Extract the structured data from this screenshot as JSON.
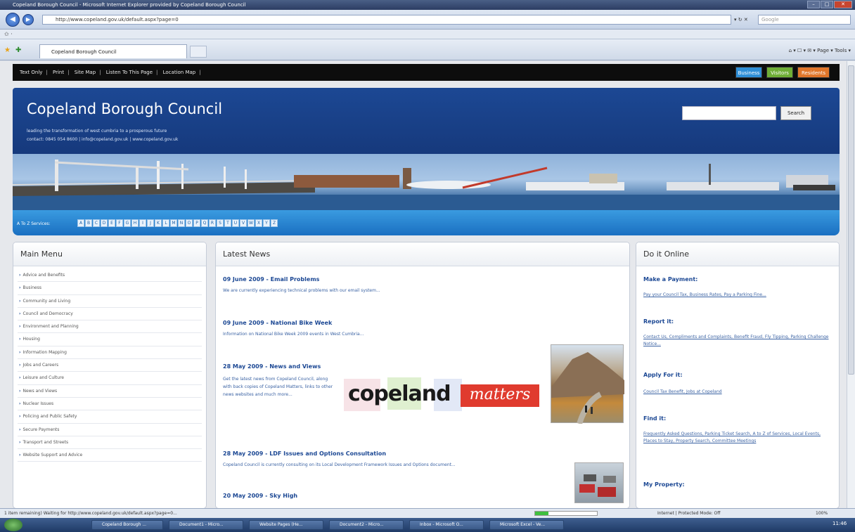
{
  "window": {
    "title": "Copeland Borough Council - Microsoft Internet Explorer provided by Copeland Borough Council"
  },
  "browser": {
    "url": "http://www.copeland.gov.uk/default.aspx?page=0",
    "search_placeholder": "Google",
    "tab_label": "Copeland Borough Council",
    "tools": "Page ▾  Tools ▾"
  },
  "utility_links": [
    "Text Only",
    "Print",
    "Site Map",
    "Listen To This Page",
    "Location Map"
  ],
  "audience_buttons": [
    {
      "label": "Business",
      "color": "#2f8fd6"
    },
    {
      "label": "Visitors",
      "color": "#6fae36"
    },
    {
      "label": "Residents",
      "color": "#e0762a"
    }
  ],
  "header": {
    "title": "Copeland Borough Council",
    "tagline": "leading the transformation of west cumbria to a prosperous future",
    "contact": "contact: 0845 054 8600 | info@copeland.gov.uk | www.copeland.gov.uk",
    "search_button": "Search"
  },
  "az": {
    "label": "A To Z Services:",
    "letters": [
      "A",
      "B",
      "C",
      "D",
      "E",
      "F",
      "G",
      "H",
      "I",
      "J",
      "K",
      "L",
      "M",
      "N",
      "O",
      "P",
      "Q",
      "R",
      "S",
      "T",
      "U",
      "V",
      "W",
      "X",
      "Y",
      "Z"
    ]
  },
  "main_menu": {
    "title": "Main Menu",
    "items": [
      "Advice and Benefits",
      "Business",
      "Community and Living",
      "Council and Democracy",
      "Environment and Planning",
      "Housing",
      "Information Mapping",
      "Jobs and Careers",
      "Leisure and Culture",
      "News and Views",
      "Nuclear Issues",
      "Policing and Public Safety",
      "Secure Payments",
      "Transport and Streets",
      "Website Support and Advice"
    ]
  },
  "news": {
    "title": "Latest News",
    "items": [
      {
        "title": "09 June 2009 - Email Problems",
        "body": "We are currently experiencing technical problems with our email system..."
      },
      {
        "title": "09 June 2009 - National Bike Week",
        "body": "Information on National Bike Week 2009 events in West Cumbria..."
      },
      {
        "title": "28 May 2009 - News and Views",
        "body": "Get the latest news from Copeland Council, along with back copies of Copeland Matters, links to other news websites and much more..."
      },
      {
        "title": "28 May 2009 - LDF Issues and Options Consultation",
        "body": "Copeland Council is currently consulting on its Local Development Framework Issues and Options document..."
      },
      {
        "title": "20 May 2009 - Sky High",
        "body": ""
      }
    ],
    "logo_left": "copeland",
    "logo_right": "matters"
  },
  "do_online": {
    "title": "Do it Online",
    "sections": [
      {
        "heading": "Make a Payment:",
        "links": "Pay your Council Tax, Business Rates, Pay a Parking Fine..."
      },
      {
        "heading": "Report it:",
        "links": "Contact Us, Compliments and Complaints, Benefit Fraud, Fly Tipping, Parking Challenge Notice..."
      },
      {
        "heading": "Apply For it:",
        "links": "Council Tax Benefit, Jobs at Copeland"
      },
      {
        "heading": "Find it:",
        "links": "Frequently Asked Questions, Parking Ticket Search, A to Z of Services, Local Events, Places to Stay, Property Search, Committee Meetings"
      },
      {
        "heading": "My Property:",
        "links": ""
      }
    ]
  },
  "status": {
    "text": "1 item remaining) Waiting for http://www.copeland.gov.uk/default.aspx?page=0...",
    "zone": "Internet | Protected Mode: Off",
    "zoom": "100%"
  },
  "taskbar": {
    "items": [
      "Copeland Borough ...",
      "Document1 - Micro...",
      "Website Pages (He...",
      "Document2 - Micro...",
      "Inbox - Microsoft O...",
      "Microsoft Excel - Ve..."
    ],
    "clock": "11:46"
  }
}
